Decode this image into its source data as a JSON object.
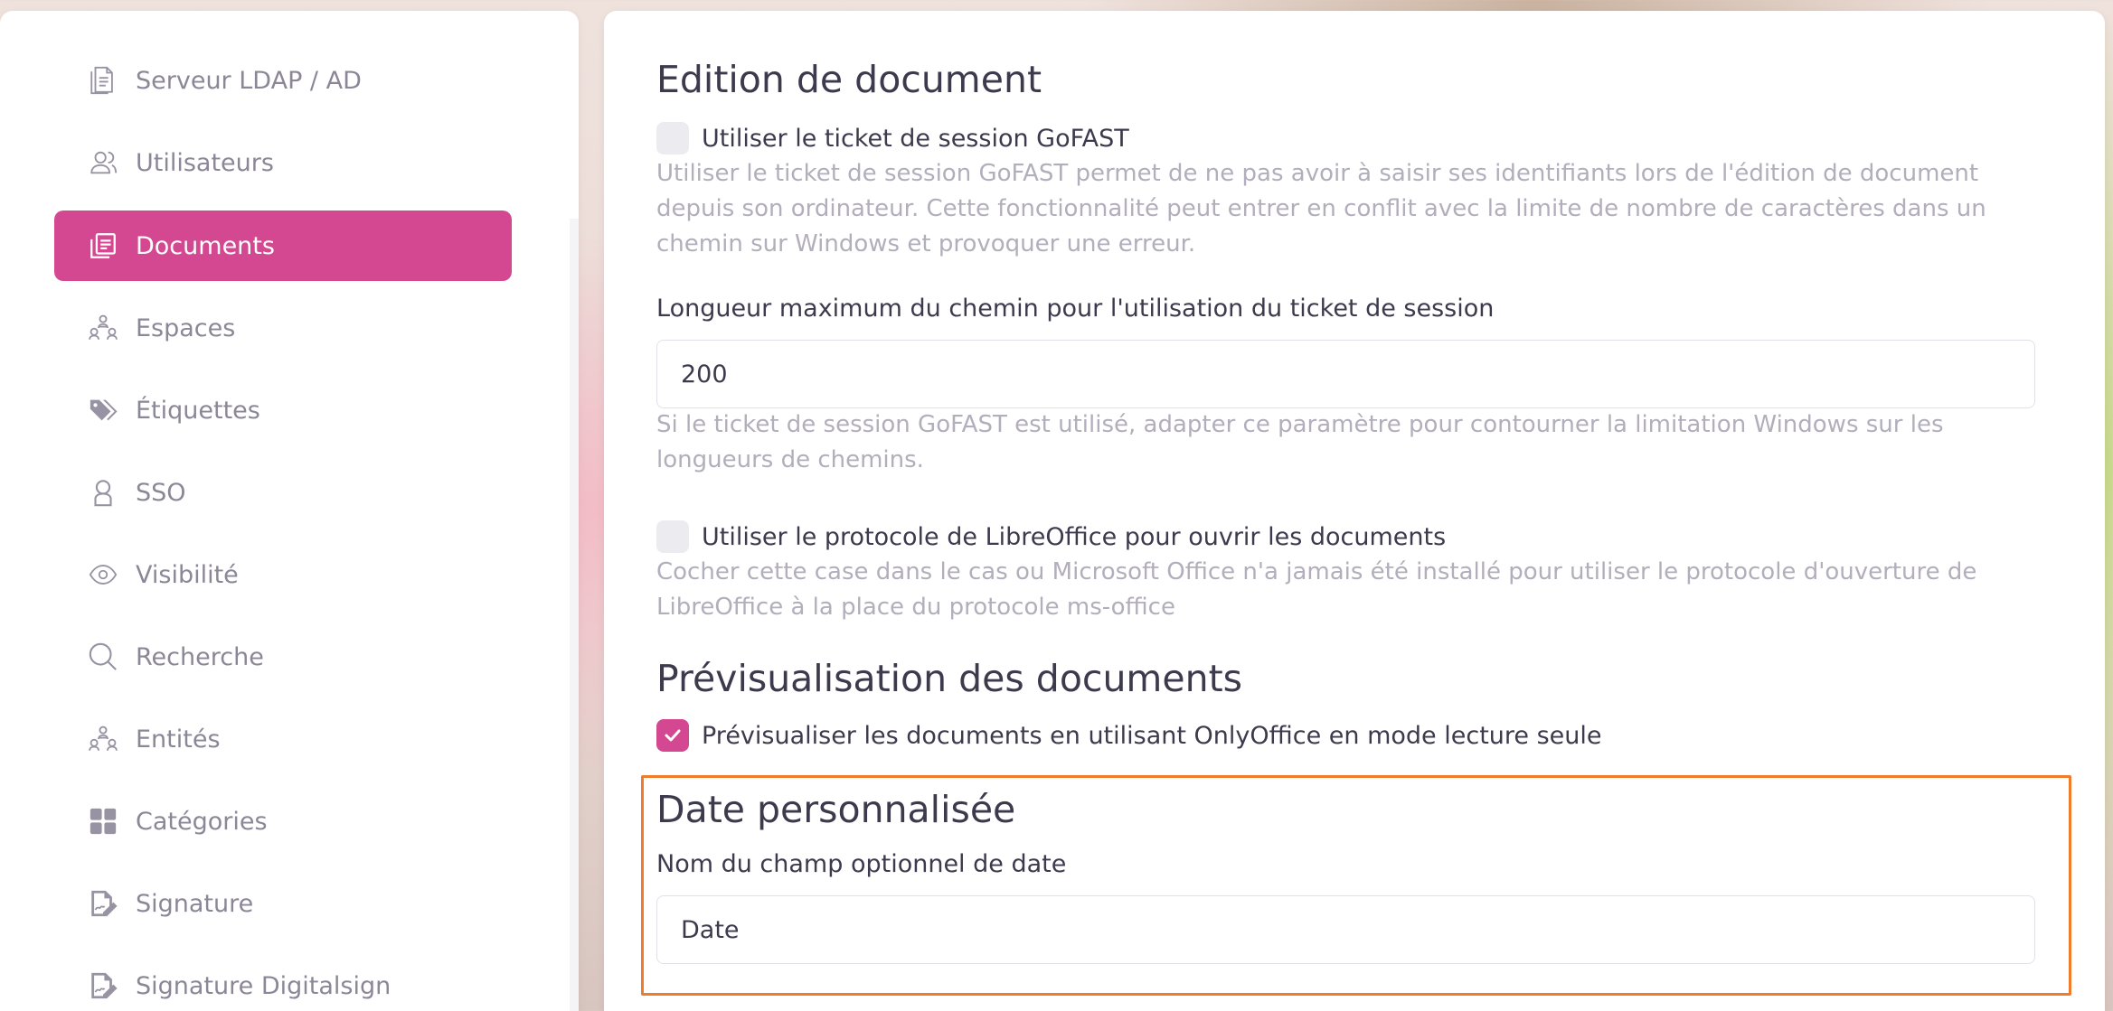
{
  "sidebar": {
    "items": [
      {
        "label": "Serveur LDAP / AD",
        "icon": "ldap-server-icon",
        "active": false
      },
      {
        "label": "Utilisateurs",
        "icon": "users-icon",
        "active": false
      },
      {
        "label": "Documents",
        "icon": "documents-icon",
        "active": true
      },
      {
        "label": "Espaces",
        "icon": "spaces-icon",
        "active": false
      },
      {
        "label": "Étiquettes",
        "icon": "tags-icon",
        "active": false
      },
      {
        "label": "SSO",
        "icon": "sso-user-icon",
        "active": false
      },
      {
        "label": "Visibilité",
        "icon": "eye-icon",
        "active": false
      },
      {
        "label": "Recherche",
        "icon": "search-icon",
        "active": false
      },
      {
        "label": "Entités",
        "icon": "entities-icon",
        "active": false
      },
      {
        "label": "Catégories",
        "icon": "categories-grid-icon",
        "active": false
      },
      {
        "label": "Signature",
        "icon": "signature-icon",
        "active": false
      },
      {
        "label": "Signature Digitalsign",
        "icon": "digitalsign-icon",
        "active": false
      }
    ]
  },
  "main": {
    "edition": {
      "title": "Edition de document",
      "session_ticket_label": "Utiliser le ticket de session GoFAST",
      "session_ticket_checked": false,
      "session_ticket_help": "Utiliser le ticket de session GoFAST permet de ne pas avoir à saisir ses identifiants lors de l'édition de document depuis son ordinateur. Cette fonctionnalité peut entrer en conflit avec la limite de nombre de caractères dans un chemin sur Windows et provoquer une erreur.",
      "max_path_label": "Longueur maximum du chemin pour l'utilisation du ticket de session",
      "max_path_value": "200",
      "max_path_help": "Si le ticket de session GoFAST est utilisé, adapter ce paramètre pour contourner la limitation Windows sur les longueurs de chemins.",
      "libreoffice_label": "Utiliser le protocole de LibreOffice pour ouvrir les documents",
      "libreoffice_checked": false,
      "libreoffice_help": "Cocher cette case dans le cas ou Microsoft Office n'a jamais été installé pour utiliser le protocole d'ouverture de LibreOffice à la place du protocole ms-office"
    },
    "preview": {
      "title": "Prévisualisation des documents",
      "onlyoffice_label": "Prévisualiser les documents en utilisant OnlyOffice en mode lecture seule",
      "onlyoffice_checked": true
    },
    "custom_date": {
      "title": "Date personnalisée",
      "field_label": "Nom du champ optionnel de date",
      "field_value": "Date"
    }
  },
  "colors": {
    "accent": "#d44892",
    "highlight": "#f07c2b"
  }
}
